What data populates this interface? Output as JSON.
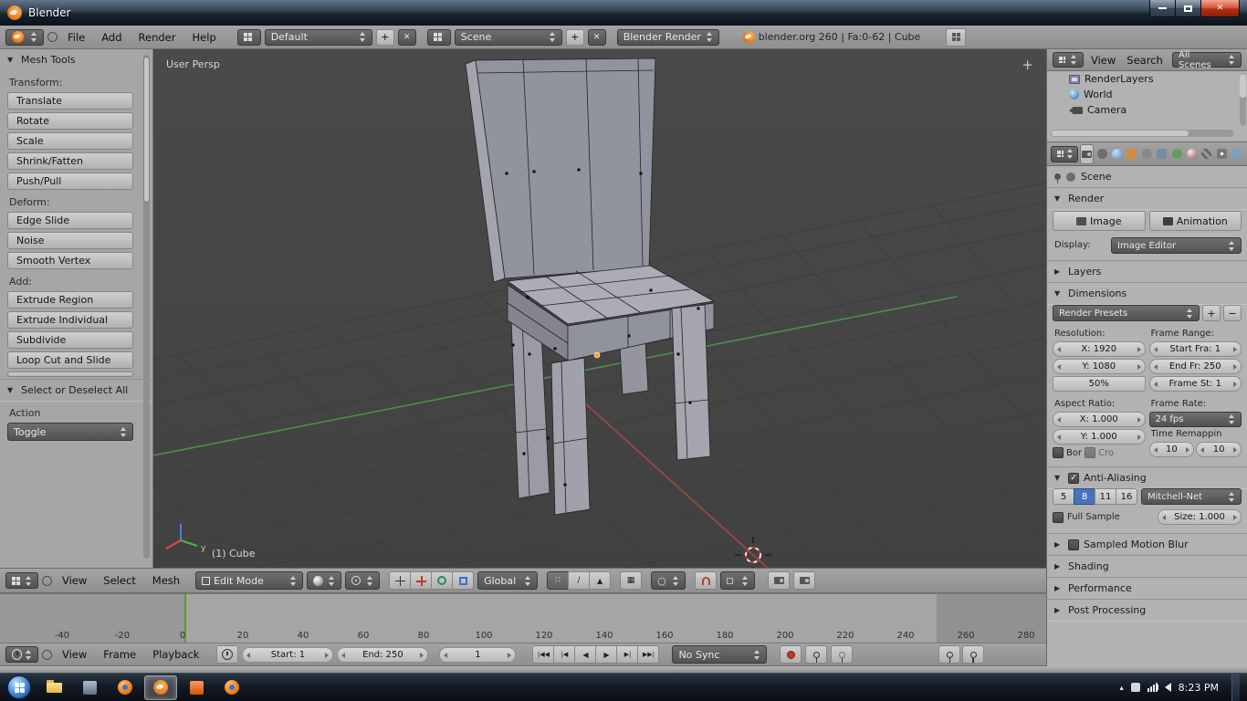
{
  "glyphs": {
    "open": "▼",
    "closed": "▶",
    "check": "✓",
    "close": "✕",
    "plus": "+",
    "minus": "−",
    "vertex": "∷",
    "edge": "∕",
    "face": "▲",
    "occlude": "▦",
    "prop_edit": "○",
    "tray_up": "▴"
  },
  "colors": {
    "accent": "#4a72b8",
    "axis_x": "#9c4a42",
    "axis_y": "#4e8f4e",
    "origin": "#ff9d2e",
    "frame_line": "#56a02e"
  },
  "titlebar": {
    "title": "Blender"
  },
  "info_header": {
    "menus": [
      "File",
      "Add",
      "Render",
      "Help"
    ],
    "layout": {
      "value": "Default"
    },
    "scene": {
      "value": "Scene"
    },
    "engine": {
      "value": "Blender Render"
    },
    "status": "blender.org 260 | Fa:0-62 | Cube"
  },
  "tool_shelf": {
    "panel_title": "Mesh Tools",
    "sections": [
      {
        "label": "Transform:",
        "buttons": [
          "Translate",
          "Rotate",
          "Scale",
          "Shrink/Fatten",
          "Push/Pull"
        ]
      },
      {
        "label": "Deform:",
        "buttons": [
          "Edge Slide",
          "Noise",
          "Smooth Vertex"
        ]
      },
      {
        "label": "Add:",
        "buttons": [
          "Extrude Region",
          "Extrude Individual",
          "Subdivide",
          "Loop Cut and Slide"
        ]
      }
    ],
    "select_panel": {
      "title": "Select or Deselect All",
      "action_label": "Action",
      "action_value": "Toggle"
    }
  },
  "viewport": {
    "view_label": "User Persp",
    "object_label": "(1) Cube",
    "gizmo_y": "y"
  },
  "view3d_header": {
    "menus": [
      "View",
      "Select",
      "Mesh"
    ],
    "mode": "Edit Mode",
    "orientation": "Global"
  },
  "timeline": {
    "ticks": [
      "-40",
      "-20",
      "0",
      "20",
      "40",
      "60",
      "80",
      "100",
      "120",
      "140",
      "160",
      "180",
      "200",
      "220",
      "240",
      "260",
      "280"
    ],
    "menus": [
      "View",
      "Frame",
      "Playback"
    ],
    "start": "Start: 1",
    "end": "End: 250",
    "current": "1",
    "playback": [
      "|◀◀",
      "|◀",
      "◀",
      "▶",
      "▶|",
      "▶▶|"
    ],
    "sync": "No Sync"
  },
  "outliner": {
    "menus": [
      "View",
      "Search"
    ],
    "scope": "All Scenes",
    "items": [
      "RenderLayers",
      "World",
      "Camera"
    ]
  },
  "properties": {
    "context": "Scene",
    "render": {
      "title": "Render",
      "image": "Image",
      "animation": "Animation",
      "display_label": "Display:",
      "display_value": "Image Editor"
    },
    "layers_title": "Layers",
    "dimensions": {
      "title": "Dimensions",
      "presets": "Render Presets",
      "resolution_label": "Resolution:",
      "frame_range_label": "Frame Range:",
      "res_x": "X: 1920",
      "res_y": "Y: 1080",
      "res_pct": "50%",
      "frame_start": "Start Fra: 1",
      "frame_end": "End Fr: 250",
      "frame_step": "Frame St: 1",
      "aspect_label": "Aspect Ratio:",
      "aspect_x": "X: 1.000",
      "aspect_y": "Y: 1.000",
      "frame_rate_label": "Frame Rate:",
      "fps": "24 fps",
      "time_remap_label": "Time Remappin",
      "border": "Bor",
      "crop": "Cro",
      "remap_old": "10",
      "remap_new": "10"
    },
    "antialiasing": {
      "title": "Anti-Aliasing",
      "samples": [
        "5",
        "8",
        "11",
        "16"
      ],
      "filter": "Mitchell-Net",
      "full_sample": "Full Sample",
      "size": "Size: 1.000"
    },
    "motion_blur_title": "Sampled Motion Blur",
    "shading_title": "Shading",
    "performance_title": "Performance",
    "post_processing_title": "Post Processing"
  },
  "taskbar": {
    "time": "8:23 PM"
  }
}
